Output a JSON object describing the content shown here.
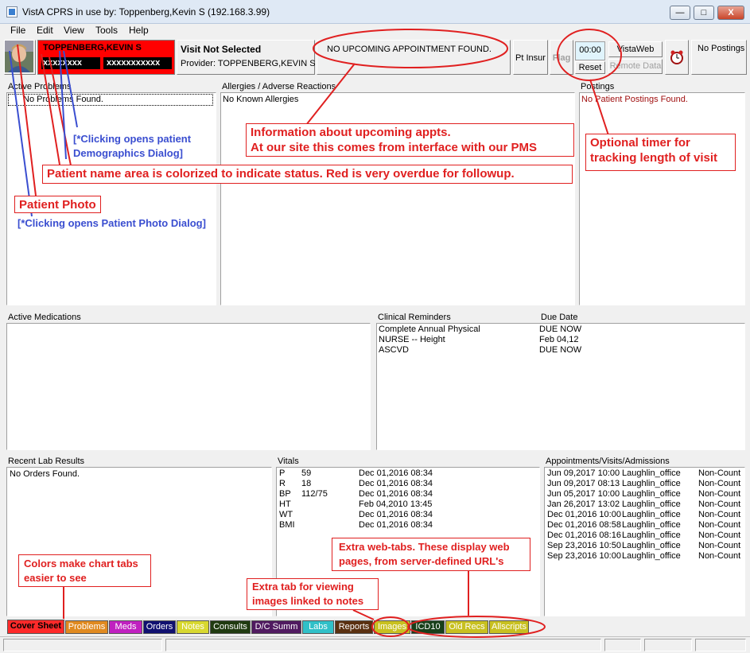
{
  "window": {
    "title": "VistA CPRS in use by: Toppenberg,Kevin S  (192.168.3.99)",
    "min_label": "—",
    "max_label": "□",
    "close_label": "X"
  },
  "menu": [
    "File",
    "Edit",
    "View",
    "Tools",
    "Help"
  ],
  "header": {
    "patient_name": "TOPPENBERG,KEVIN S",
    "patient_id1": "xxxxxxxx",
    "patient_id2": "xxxxxxxxxxx",
    "visit_title": "Visit Not Selected",
    "provider": "Provider:  TOPPENBERG,KEVIN S",
    "appointment": "NO UPCOMING APPOINTMENT FOUND.",
    "pt_insur": "Pt Insur",
    "flag": "Flag",
    "timer": "00:00",
    "reset": "Reset",
    "vistaweb": "VistaWeb",
    "remote_data": "Remote Data",
    "postings_btn": "No Postings",
    "name_bg_color": "#ff0000"
  },
  "panels": {
    "problems": {
      "label": "Active Problems",
      "text": "No Problems Found."
    },
    "allergies": {
      "label": "Allergies / Adverse Reactions",
      "text": "No Known Allergies"
    },
    "postings": {
      "label": "Postings",
      "text": "No Patient Postings Found."
    },
    "medications": {
      "label": "Active Medications"
    },
    "reminders": {
      "label": "Clinical Reminders",
      "due_label": "Due Date",
      "items": [
        {
          "name": "Complete Annual Physical",
          "due": "DUE NOW"
        },
        {
          "name": "NURSE -- Height",
          "due": "Feb 04,12"
        },
        {
          "name": "ASCVD",
          "due": "DUE NOW"
        }
      ]
    },
    "labs": {
      "label": "Recent Lab Results",
      "text": "No Orders Found."
    },
    "vitals": {
      "label": "Vitals",
      "items": [
        {
          "name": "P",
          "value": "59",
          "date": "Dec 01,2016 08:34"
        },
        {
          "name": "R",
          "value": "18",
          "date": "Dec 01,2016 08:34"
        },
        {
          "name": "BP",
          "value": "112/75",
          "date": "Dec 01,2016 08:34"
        },
        {
          "name": "HT",
          "value": "",
          "date": "Feb 04,2010 13:45"
        },
        {
          "name": "WT",
          "value": "",
          "date": "Dec 01,2016 08:34"
        },
        {
          "name": "BMI",
          "value": "",
          "date": "Dec 01,2016 08:34"
        }
      ]
    },
    "appointments": {
      "label": "Appointments/Visits/Admissions",
      "items": [
        {
          "date": "Jun 09,2017 10:00",
          "loc": "Laughlin_office",
          "status": "Non-Count"
        },
        {
          "date": "Jun 09,2017 08:13",
          "loc": "Laughlin_office",
          "status": "Non-Count"
        },
        {
          "date": "Jun 05,2017 10:00",
          "loc": "Laughlin_office",
          "status": "Non-Count"
        },
        {
          "date": "Jan 26,2017 13:02",
          "loc": "Laughlin_office",
          "status": "Non-Count"
        },
        {
          "date": "Dec 01,2016 10:00",
          "loc": "Laughlin_office",
          "status": "Non-Count"
        },
        {
          "date": "Dec 01,2016 08:58",
          "loc": "Laughlin_office",
          "status": "Non-Count"
        },
        {
          "date": "Dec 01,2016 08:16",
          "loc": "Laughlin_office",
          "status": "Non-Count"
        },
        {
          "date": "Sep 23,2016 10:50",
          "loc": "Laughlin_office",
          "status": "Non-Count"
        },
        {
          "date": "Sep 23,2016 10:00",
          "loc": "Laughlin_office",
          "status": "Non-Count"
        }
      ]
    }
  },
  "tabs": [
    {
      "label": "Cover Sheet",
      "bg": "#ff2a2a",
      "fg": "#000000"
    },
    {
      "label": "Problems",
      "bg": "#e08a20",
      "fg": "#ffffff"
    },
    {
      "label": "Meds",
      "bg": "#c020c0",
      "fg": "#ffffff"
    },
    {
      "label": "Orders",
      "bg": "#101070",
      "fg": "#ffffff"
    },
    {
      "label": "Notes",
      "bg": "#d8d830",
      "fg": "#ffffff"
    },
    {
      "label": "Consults",
      "bg": "#203a10",
      "fg": "#ffffff"
    },
    {
      "label": "D/C Summ",
      "bg": "#501a60",
      "fg": "#ffffff"
    },
    {
      "label": "Labs",
      "bg": "#30c0c8",
      "fg": "#ffffff"
    },
    {
      "label": "Reports",
      "bg": "#5a3010",
      "fg": "#ffffff"
    },
    {
      "label": "Images",
      "bg": "#c8c020",
      "fg": "#ffffff"
    },
    {
      "label": "ICD10",
      "bg": "#18401a",
      "fg": "#ffffff"
    },
    {
      "label": "Old Recs",
      "bg": "#c8c020",
      "fg": "#ffffff"
    },
    {
      "label": "Allscripts",
      "bg": "#c8c020",
      "fg": "#ffffff"
    }
  ],
  "annotations": {
    "appts_line1": "Information about upcoming appts.",
    "appts_line2": "At our site this comes from interface with our PMS",
    "timer_line1": "Optional timer for",
    "timer_line2": "tracking length of visit",
    "demog_line1": "[*Clicking opens patient",
    "demog_line2": "Demographics Dialog]",
    "name_color": "Patient name area is colorized to indicate status.  Red is very overdue for followup.",
    "photo": "Patient Photo",
    "photo_click": "[*Clicking opens Patient Photo Dialog]",
    "webtabs_line1": "Extra web-tabs.  These display web",
    "webtabs_line2": "pages, from server-defined URL's",
    "colors_line1": "Colors make chart tabs",
    "colors_line2": "easier to see",
    "images_line1": "Extra tab for viewing",
    "images_line2": "images linked to notes",
    "red_color": "#e02020",
    "blue_color": "#3a4ed0"
  }
}
